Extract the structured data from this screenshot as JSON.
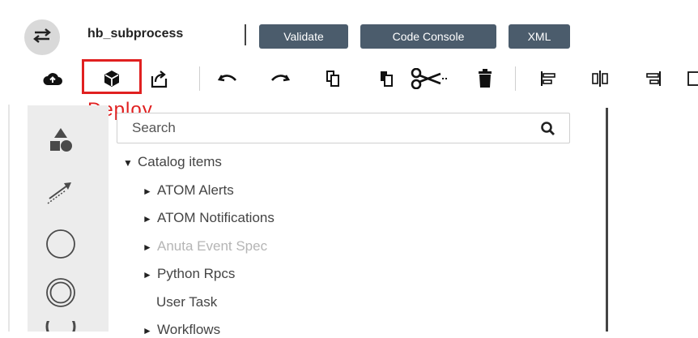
{
  "header": {
    "title": "hb_subprocess",
    "buttons": {
      "validate": "Validate",
      "code_console": "Code Console",
      "xml": "XML"
    }
  },
  "toolbar": {
    "icons": [
      "cloud-upload-icon",
      "deploy-cube-icon",
      "export-icon",
      "undo-icon",
      "redo-icon",
      "copy-icon",
      "paste-icon",
      "cut-icon",
      "delete-icon",
      "align-left-icon",
      "align-center-icon",
      "align-right-icon"
    ]
  },
  "annotation": {
    "deploy_label": "Deploy"
  },
  "palette": {
    "search_placeholder": "Search",
    "catalog": {
      "label": "Catalog items",
      "items": [
        {
          "label": "ATOM Alerts",
          "expandable": true,
          "disabled": false
        },
        {
          "label": "ATOM Notifications",
          "expandable": true,
          "disabled": false
        },
        {
          "label": "Anuta Event Spec",
          "expandable": true,
          "disabled": true
        },
        {
          "label": "Python Rpcs",
          "expandable": true,
          "disabled": false
        },
        {
          "label": "User Task",
          "expandable": false,
          "disabled": false
        },
        {
          "label": "Workflows",
          "expandable": true,
          "disabled": false
        }
      ]
    }
  },
  "rail": {
    "icons": [
      "shapes-icon",
      "connector-arrow-icon",
      "start-event-circle-icon",
      "intermediate-event-circle-icon",
      "end-event-icon"
    ]
  },
  "colors": {
    "header_button_bg": "#4b5c6c",
    "highlight_red": "#e02020",
    "rail_bg": "#ececec"
  }
}
